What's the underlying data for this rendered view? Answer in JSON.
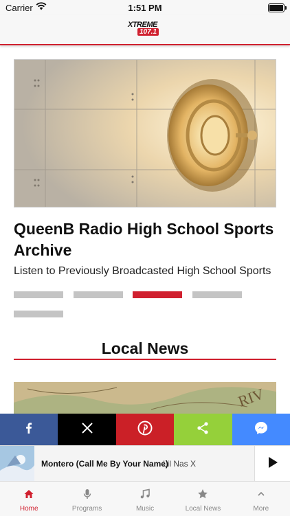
{
  "status_bar": {
    "carrier": "Carrier",
    "time": "1:51 PM"
  },
  "header": {
    "logo_line1": "XTREME",
    "logo_line2": "107.1"
  },
  "featured": {
    "image_icon": "vault-door-image",
    "title": "QueenB Radio High School Sports Archive",
    "subtitle": "Listen to Previously Broadcasted High School Sports",
    "carousel_pages": 5,
    "carousel_active_index": 2
  },
  "section": {
    "title": "Local News"
  },
  "share": [
    {
      "name": "facebook",
      "icon": "facebook-icon",
      "color": "#3b5998"
    },
    {
      "name": "x",
      "icon": "x-icon",
      "color": "#000000"
    },
    {
      "name": "pinterest",
      "icon": "pinterest-icon",
      "color": "#cb2027"
    },
    {
      "name": "share",
      "icon": "share-icon",
      "color": "#95d03a"
    },
    {
      "name": "messenger",
      "icon": "messenger-icon",
      "color": "#448aff"
    }
  ],
  "now_playing": {
    "song": "Montero (Call Me By Your Name)",
    "artist": "Lil Nas X",
    "play_icon": "play-icon"
  },
  "tabs": [
    {
      "label": "Home",
      "icon": "home-icon",
      "active": true
    },
    {
      "label": "Programs",
      "icon": "microphone-icon",
      "active": false
    },
    {
      "label": "Music",
      "icon": "music-note-icon",
      "active": false
    },
    {
      "label": "Local News",
      "icon": "star-icon",
      "active": false
    },
    {
      "label": "More",
      "icon": "chevron-up-icon",
      "active": false
    }
  ],
  "colors": {
    "accent": "#d0202f",
    "inactive_tab": "#888888",
    "carousel_dot": "#c4c4c4"
  }
}
